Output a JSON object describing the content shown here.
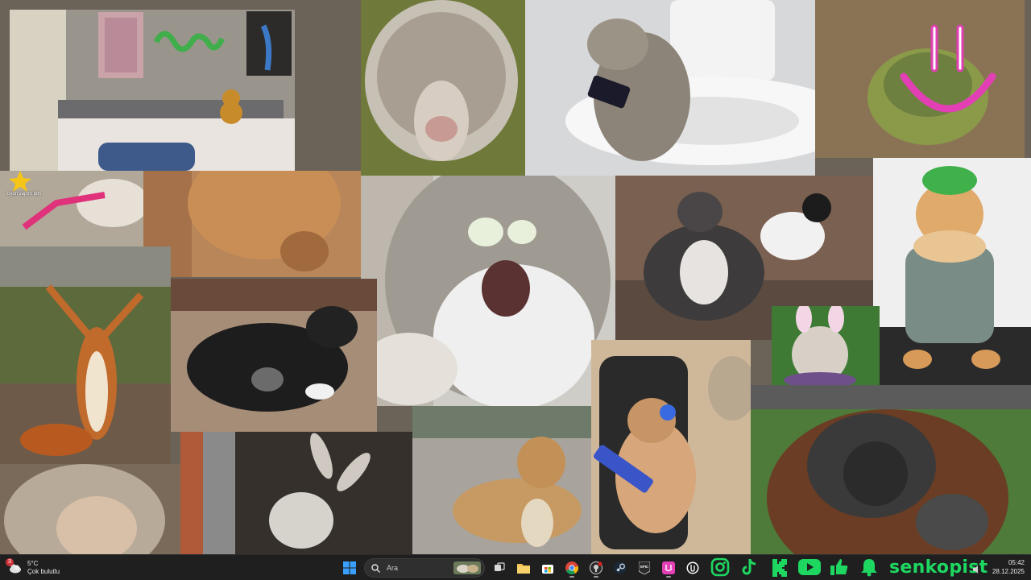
{
  "desktop": {
    "sticker_caption": "oydn yapım bitti"
  },
  "taskbar": {
    "weather": {
      "temperature": "5°C",
      "condition": "Çok bulutlu",
      "badge_count": "3"
    },
    "search": {
      "placeholder": "Ara"
    },
    "pinned_apps": [
      {
        "name": "start",
        "icon": "windows-logo-icon"
      },
      {
        "name": "task-view",
        "icon": "task-view-icon"
      },
      {
        "name": "file-explorer",
        "icon": "folder-icon"
      },
      {
        "name": "store",
        "icon": "store-icon"
      },
      {
        "name": "chrome",
        "icon": "chrome-icon"
      },
      {
        "name": "github",
        "icon": "github-icon"
      },
      {
        "name": "steam",
        "icon": "steam-icon"
      },
      {
        "name": "epic-games",
        "icon": "epic-games-icon",
        "label": "EPIC"
      },
      {
        "name": "app-pink",
        "icon": "pink-app-icon"
      },
      {
        "name": "unreal",
        "icon": "unreal-icon"
      }
    ],
    "social": {
      "handle": "senkopist",
      "color": "#1ed760",
      "icons": [
        "instagram-icon",
        "tiktok-icon",
        "kick-icon",
        "youtube-icon",
        "thumbs-up-icon",
        "bell-icon"
      ]
    },
    "clock": {
      "time": "05:42",
      "date": "28.12.2025"
    }
  }
}
